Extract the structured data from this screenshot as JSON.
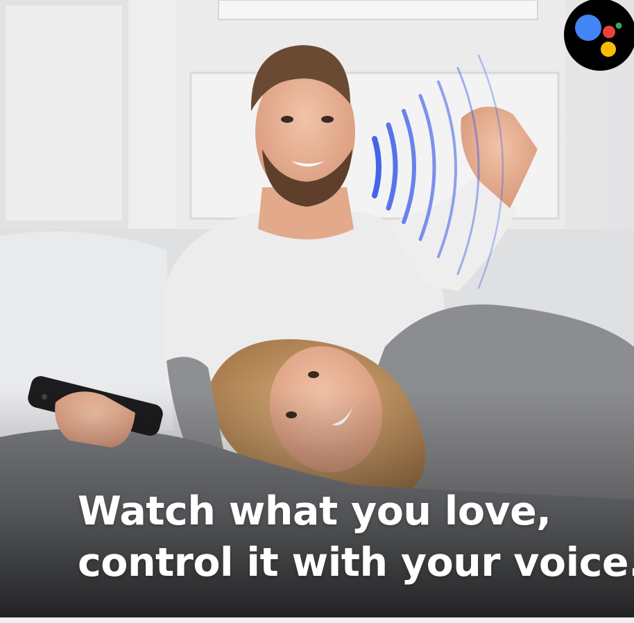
{
  "headline": {
    "line1": "Watch what you love,",
    "line2": "control it with your voice."
  },
  "badge": {
    "icon": "google-assistant-icon",
    "colors": {
      "background": "#000000",
      "blue": "#4285F4",
      "red": "#EA4335",
      "yellow": "#FBBC05",
      "green": "#34A853"
    }
  },
  "colors": {
    "voice_waves": "#3b5ce8",
    "caption_text": "#ffffff",
    "bottom_shade": "#111111"
  }
}
